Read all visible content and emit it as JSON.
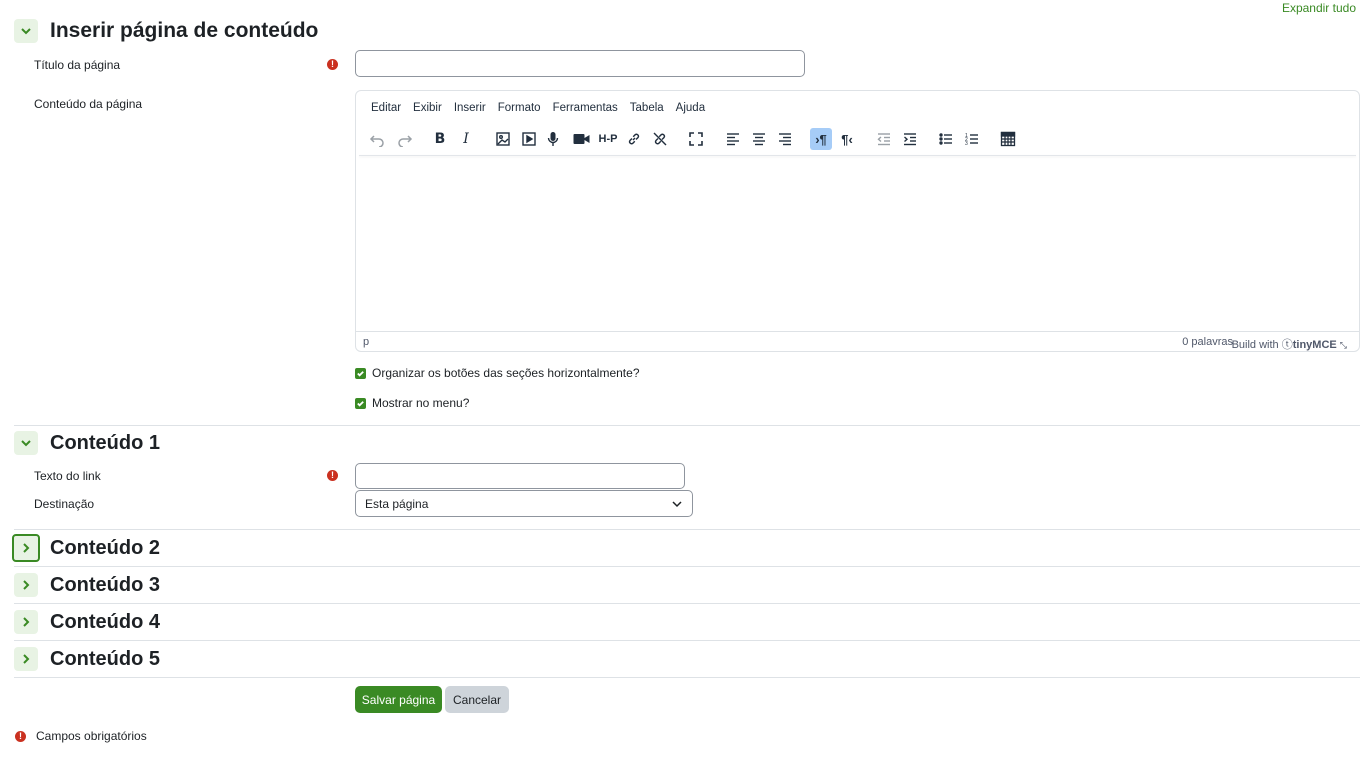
{
  "expand_all": "Expandir tudo",
  "required_mark": "!",
  "main_section": {
    "title": "Inserir página de conteúdo",
    "page_title_label": "Título da página",
    "page_title_value": "",
    "page_content_label": "Conteúdo da página"
  },
  "editor": {
    "menu": [
      "Editar",
      "Exibir",
      "Inserir",
      "Formato",
      "Ferramentas",
      "Tabela",
      "Ajuda"
    ],
    "status_path": "p",
    "word_count": "0 palavras",
    "brand_prefix": "Build with",
    "brand_name": "tinyMCE",
    "h5p_label": "H-P"
  },
  "options": {
    "horizontal_buttons": "Organizar os botões das seções horizontalmente?",
    "show_in_menu": "Mostrar no menu?"
  },
  "content_sections": [
    {
      "title": "Conteúdo 1",
      "link_text_label": "Texto do link",
      "link_text_value": "",
      "destination_label": "Destinação",
      "destination_value": "Esta página"
    },
    {
      "title": "Conteúdo 2"
    },
    {
      "title": "Conteúdo 3"
    },
    {
      "title": "Conteúdo 4"
    },
    {
      "title": "Conteúdo 5"
    }
  ],
  "buttons": {
    "save": "Salvar página",
    "cancel": "Cancelar"
  },
  "required_note": "Campos obrigatórios",
  "colors": {
    "accent": "#3a8a24",
    "required": "#ca3120"
  }
}
